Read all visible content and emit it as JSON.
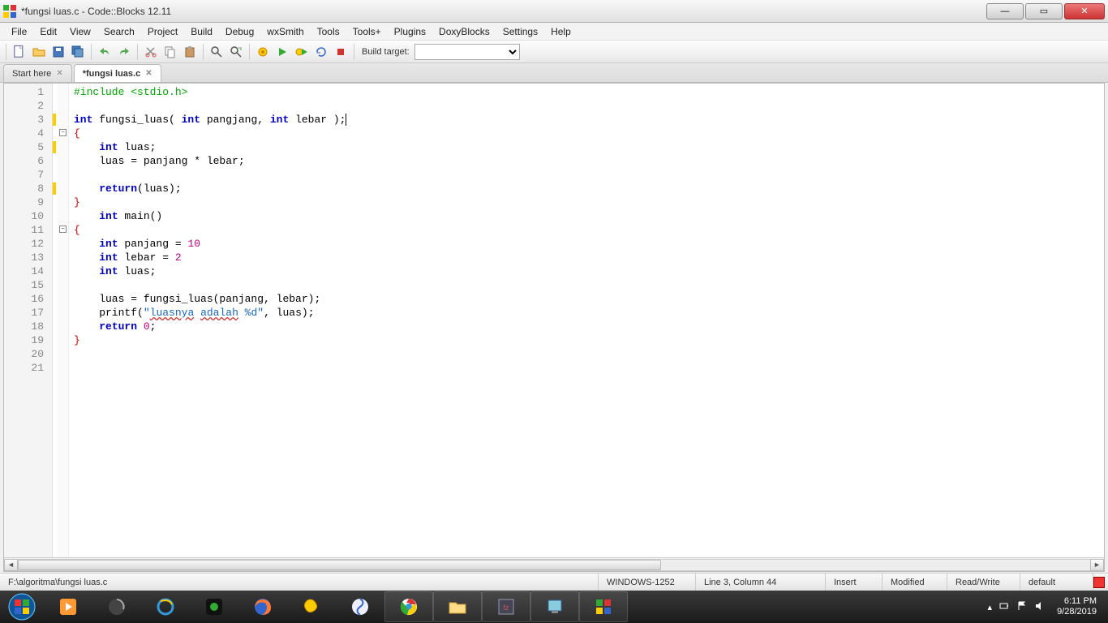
{
  "window": {
    "title": "*fungsi luas.c - Code::Blocks 12.11"
  },
  "menu": [
    "File",
    "Edit",
    "View",
    "Search",
    "Project",
    "Build",
    "Debug",
    "wxSmith",
    "Tools",
    "Tools+",
    "Plugins",
    "DoxyBlocks",
    "Settings",
    "Help"
  ],
  "toolbar": {
    "build_target_label": "Build target:"
  },
  "tabs": [
    {
      "label": "Start here",
      "active": false
    },
    {
      "label": "*fungsi luas.c",
      "active": true
    }
  ],
  "code": {
    "line_count": 21,
    "change_markers": [
      3,
      5,
      8
    ],
    "fold_markers": [
      {
        "line": 4,
        "symbol": "−"
      },
      {
        "line": 11,
        "symbol": "−"
      }
    ],
    "lines": [
      {
        "n": 1,
        "segs": [
          {
            "t": "#include <stdio.h>",
            "c": "tok-pp"
          }
        ]
      },
      {
        "n": 2,
        "segs": []
      },
      {
        "n": 3,
        "segs": [
          {
            "t": "int",
            "c": "tok-kw"
          },
          {
            "t": " fungsi_luas( "
          },
          {
            "t": "int",
            "c": "tok-kw"
          },
          {
            "t": " pangjang, "
          },
          {
            "t": "int",
            "c": "tok-kw"
          },
          {
            "t": " lebar );",
            "caret": true
          }
        ]
      },
      {
        "n": 4,
        "segs": [
          {
            "t": "{",
            "c": "tok-brace"
          }
        ]
      },
      {
        "n": 5,
        "segs": [
          {
            "t": "    "
          },
          {
            "t": "int",
            "c": "tok-kw"
          },
          {
            "t": " luas;"
          }
        ]
      },
      {
        "n": 6,
        "segs": [
          {
            "t": "    luas = panjang * lebar;"
          }
        ]
      },
      {
        "n": 7,
        "segs": []
      },
      {
        "n": 8,
        "segs": [
          {
            "t": "    "
          },
          {
            "t": "return",
            "c": "tok-kw"
          },
          {
            "t": "(luas);"
          }
        ]
      },
      {
        "n": 9,
        "segs": [
          {
            "t": "}",
            "c": "tok-brace"
          }
        ]
      },
      {
        "n": 10,
        "segs": [
          {
            "t": "    "
          },
          {
            "t": "int",
            "c": "tok-kw"
          },
          {
            "t": " main()"
          }
        ]
      },
      {
        "n": 11,
        "segs": [
          {
            "t": "{",
            "c": "tok-brace"
          }
        ]
      },
      {
        "n": 12,
        "segs": [
          {
            "t": "    "
          },
          {
            "t": "int",
            "c": "tok-kw"
          },
          {
            "t": " panjang = "
          },
          {
            "t": "10",
            "c": "tok-num"
          }
        ]
      },
      {
        "n": 13,
        "segs": [
          {
            "t": "    "
          },
          {
            "t": "int",
            "c": "tok-kw"
          },
          {
            "t": " lebar = "
          },
          {
            "t": "2",
            "c": "tok-num"
          }
        ]
      },
      {
        "n": 14,
        "segs": [
          {
            "t": "    "
          },
          {
            "t": "int",
            "c": "tok-kw"
          },
          {
            "t": " luas;"
          }
        ]
      },
      {
        "n": 15,
        "segs": []
      },
      {
        "n": 16,
        "segs": [
          {
            "t": "    luas = fungsi_luas(panjang, lebar);"
          }
        ]
      },
      {
        "n": 17,
        "segs": [
          {
            "t": "    printf("
          },
          {
            "t": "\"",
            "c": "tok-str"
          },
          {
            "t": "luasnya",
            "c": "tok-str tok-wavy"
          },
          {
            "t": " ",
            "c": "tok-str"
          },
          {
            "t": "adalah",
            "c": "tok-str tok-wavy"
          },
          {
            "t": " %d\"",
            "c": "tok-str"
          },
          {
            "t": ", luas);"
          }
        ]
      },
      {
        "n": 18,
        "segs": [
          {
            "t": "    "
          },
          {
            "t": "return",
            "c": "tok-kw"
          },
          {
            "t": " "
          },
          {
            "t": "0",
            "c": "tok-num"
          },
          {
            "t": ";"
          }
        ]
      },
      {
        "n": 19,
        "segs": [
          {
            "t": "}",
            "c": "tok-brace"
          }
        ]
      },
      {
        "n": 20,
        "segs": []
      },
      {
        "n": 21,
        "segs": []
      }
    ]
  },
  "status": {
    "path": "F:\\algoritma\\fungsi luas.c",
    "encoding": "WINDOWS-1252",
    "cursor": "Line 3, Column 44",
    "insert": "Insert",
    "modified": "Modified",
    "readwrite": "Read/Write",
    "profile": "default"
  },
  "tray": {
    "time": "6:11 PM",
    "date": "9/28/2019"
  }
}
